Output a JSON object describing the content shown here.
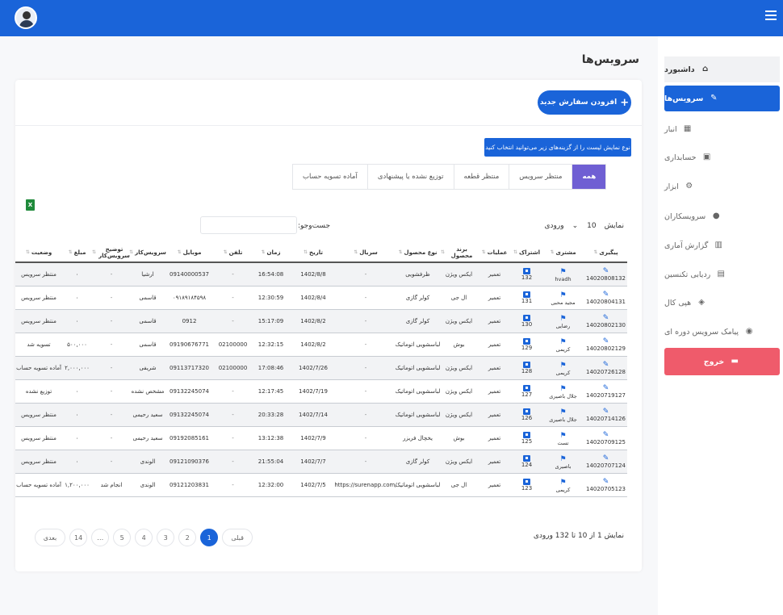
{
  "page_title": "سرویس‌ها",
  "sidebar": {
    "items": [
      {
        "label": "داشبورد",
        "icon": "home-icon",
        "glyph": "⌂"
      },
      {
        "label": "سرویس‌ها",
        "icon": "edit-icon",
        "glyph": "✎"
      },
      {
        "label": "انبار",
        "icon": "boxes-icon",
        "glyph": "▦"
      },
      {
        "label": "حسابداری",
        "icon": "money-icon",
        "glyph": "▣"
      },
      {
        "label": "ابزار",
        "icon": "gears-icon",
        "glyph": "⚙"
      },
      {
        "label": "سرویسکاران",
        "icon": "user-circle-icon",
        "glyph": "●"
      },
      {
        "label": "گزارش آماری",
        "icon": "chart-icon",
        "glyph": "▥"
      },
      {
        "label": "ردیابی تکنسین",
        "icon": "map-icon",
        "glyph": "▤"
      },
      {
        "label": "هپی کال",
        "icon": "layers-icon",
        "glyph": "◈"
      },
      {
        "label": "پیامک سرویس دوره ای",
        "icon": "comment-icon",
        "glyph": "◉"
      }
    ],
    "logout": {
      "label": "خروج",
      "icon": "id-card-icon",
      "glyph": "▬"
    }
  },
  "card": {
    "add_button": "افزودن سفارش جدید",
    "hint": "نوع نمایش لیست را از گزینه‌های زیر می‌توانید انتخاب کنید",
    "tabs": [
      "همه",
      "منتظر سرویس",
      "منتظر قطعه",
      "توزیع نشده یا پیشنهادی",
      "آماده تسویه حساب"
    ],
    "show_label": "نمایش",
    "show_value": "10",
    "entries_label": "ورودی",
    "search_label": "جست‌وجو:",
    "excel_label": "X"
  },
  "table": {
    "columns": [
      "پیگیری",
      "مشتری",
      "اشتراک",
      "عملیات",
      "برند محصول",
      "نوع محصول",
      "سریال",
      "تاریخ",
      "زمان",
      "تلفن",
      "موبایل",
      "سرویس‌کار",
      "توضیح سرویس‌کار",
      "مبلغ",
      "وضعیت"
    ],
    "rows": [
      {
        "id": "14020808132",
        "customer": "hvadh",
        "sub": "132",
        "op": "تعمیر",
        "brand": "ایکس ویژن",
        "type": "ظرفشویی",
        "serial": "-",
        "date": "1402/8/8",
        "time": "16:54:08",
        "phone": "-",
        "mobile": "09140000537",
        "tech": "ارشیا",
        "note": "-",
        "amount": "۰",
        "status": "منتظر سرویس"
      },
      {
        "id": "14020804131",
        "customer": "مجید محبی",
        "sub": "131",
        "op": "تعمیر",
        "brand": "ال جی",
        "type": "کولر گازی",
        "serial": "-",
        "date": "1402/8/4",
        "time": "12:30:59",
        "phone": "-",
        "mobile": "۰۹۱۸۹۱۸۴۵۹۸",
        "tech": "قاسمی",
        "note": "-",
        "amount": "۰",
        "status": "منتظر سرویس"
      },
      {
        "id": "14020802130",
        "customer": "رضایی",
        "sub": "130",
        "op": "تعمیر",
        "brand": "ایکس ویژن",
        "type": "کولر گازی",
        "serial": "-",
        "date": "1402/8/2",
        "time": "15:17:09",
        "phone": "-",
        "mobile": "0912",
        "tech": "قاسمی",
        "note": "-",
        "amount": "۰",
        "status": "منتظر سرویس"
      },
      {
        "id": "14020802129",
        "customer": "کریمی",
        "sub": "129",
        "op": "تعمیر",
        "brand": "بوش",
        "type": "لباسشویی اتوماتیک",
        "serial": "-",
        "date": "1402/8/2",
        "time": "12:32:15",
        "phone": "02100000",
        "mobile": "09190676771",
        "tech": "قاسمی",
        "note": "-",
        "amount": "۵۰۰,۰۰۰",
        "status": "تسویه شد"
      },
      {
        "id": "14020726128",
        "customer": "کریمی",
        "sub": "128",
        "op": "تعمیر",
        "brand": "ایکس ویژن",
        "type": "لباسشویی اتوماتیک",
        "serial": "-",
        "date": "1402/7/26",
        "time": "17:08:46",
        "phone": "02100000",
        "mobile": "09113717320",
        "tech": "شریفی",
        "note": "-",
        "amount": "۲,۰۰۰,۰۰۰",
        "status": "آماده تسویه حساب"
      },
      {
        "id": "14020719127",
        "customer": "جلال باصیری",
        "sub": "127",
        "op": "تعمیر",
        "brand": "ایکس ویژن",
        "type": "لباسشویی اتوماتیک",
        "serial": "-",
        "date": "1402/7/19",
        "time": "12:17:45",
        "phone": "-",
        "mobile": "09132245074",
        "tech": "مشخص نشده",
        "note": "-",
        "amount": "۰",
        "status": "توزیع نشده"
      },
      {
        "id": "14020714126",
        "customer": "جلال باصیری",
        "sub": "126",
        "op": "تعمیر",
        "brand": "ایکس ویژن",
        "type": "لباسشویی اتوماتیک",
        "serial": "-",
        "date": "1402/7/14",
        "time": "20:33:28",
        "phone": "-",
        "mobile": "09132245074",
        "tech": "سعید رحیمی",
        "note": "-",
        "amount": "۰",
        "status": "منتظر سرویس"
      },
      {
        "id": "14020709125",
        "customer": "تست",
        "sub": "125",
        "op": "تعمیر",
        "brand": "بوش",
        "type": "یخچال فریزر",
        "serial": "-",
        "date": "1402/7/9",
        "time": "13:12:38",
        "phone": "-",
        "mobile": "09192085161",
        "tech": "سعید رحیمی",
        "note": "-",
        "amount": "۰",
        "status": "منتظر سرویس"
      },
      {
        "id": "14020707124",
        "customer": "باصیری",
        "sub": "124",
        "op": "تعمیر",
        "brand": "ایکس ویژن",
        "type": "کولر گازی",
        "serial": "-",
        "date": "1402/7/7",
        "time": "21:55:04",
        "phone": "-",
        "mobile": "09121090376",
        "tech": "الوندی",
        "note": "-",
        "amount": "۰",
        "status": "منتظر سرویس"
      },
      {
        "id": "14020705123",
        "customer": "کریمی",
        "sub": "123",
        "op": "تعمیر",
        "brand": "ال جی",
        "type": "لباسشویی اتوماتیک",
        "serial": "/https://surenapp.com",
        "date": "1402/7/5",
        "time": "12:32:00",
        "phone": "-",
        "mobile": "09121203831",
        "tech": "الوندی",
        "note": "انجام شد",
        "amount": "۱,۲۰۰,۰۰۰",
        "status": "آماده تسویه حساب"
      }
    ]
  },
  "pagination": {
    "info": "نمایش 1 از 10 تا 132 ورودی",
    "prev": "قبلی",
    "pages": [
      "1",
      "2",
      "3",
      "4",
      "5",
      "…",
      "14"
    ],
    "next": "بعدی",
    "current": "1"
  },
  "colors": {
    "primary": "#1a64d9",
    "danger": "#ef5b6b",
    "tab_active": "#6f5fd3"
  }
}
